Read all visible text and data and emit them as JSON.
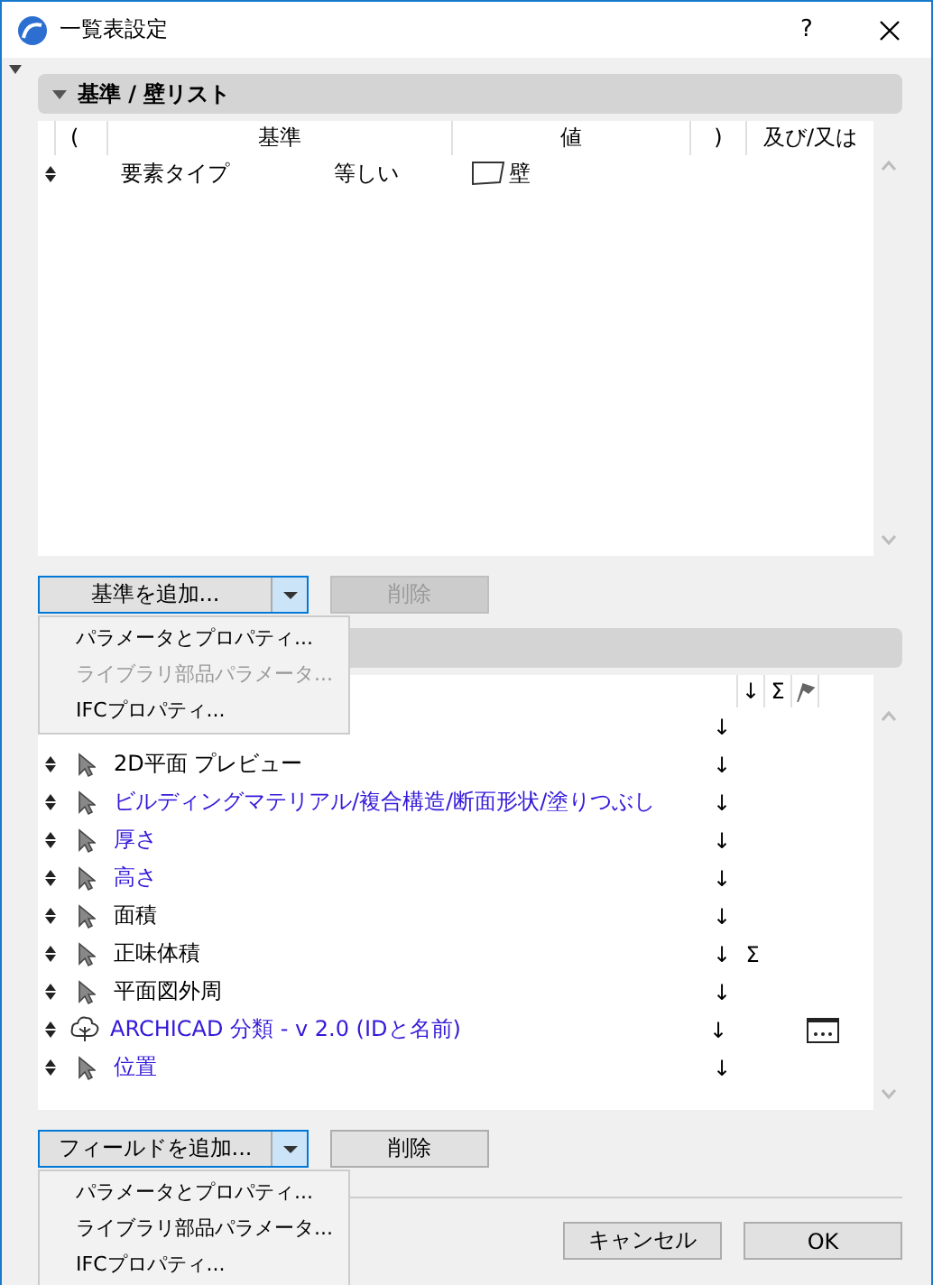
{
  "window": {
    "title": "一覧表設定",
    "help": "?"
  },
  "criteria_section": {
    "title": "基準 /  壁リスト",
    "expanded": true
  },
  "criteria_table": {
    "columns": [
      "(",
      "基準",
      "値",
      ")",
      "及び/又は"
    ],
    "rows": [
      {
        "criterion": "要素タイプ",
        "operator": "等しい",
        "value": "壁"
      }
    ]
  },
  "criteria_buttons": {
    "add": "基準を追加...",
    "delete": "削除",
    "delete_disabled": true
  },
  "criteria_menu": [
    {
      "label": "パラメータとプロパティ...",
      "disabled": false
    },
    {
      "label": "ライブラリ部品パラメータ...",
      "disabled": true
    },
    {
      "label": "IFCプロパティ...",
      "disabled": false
    }
  ],
  "fields_header": {
    "sort": "↓",
    "sum": "Σ"
  },
  "fields": [
    {
      "sort": "↓"
    },
    {
      "kind": "cursor",
      "name": "2D平面 プレビュー",
      "color": "#000000",
      "sort": "↓"
    },
    {
      "kind": "cursor",
      "name": "ビルディングマテリアル/複合構造/断面形状/塗りつぶし",
      "color": "#3319d9",
      "sort": "↓"
    },
    {
      "kind": "cursor",
      "name": "厚さ",
      "color": "#3319d9",
      "sort": "↓"
    },
    {
      "kind": "cursor",
      "name": "高さ",
      "color": "#3319d9",
      "sort": "↓"
    },
    {
      "kind": "cursor",
      "name": "面積",
      "color": "#000000",
      "sort": "↓"
    },
    {
      "kind": "cursor",
      "name": "正味体積",
      "color": "#000000",
      "sort": "↓",
      "sum": "Σ"
    },
    {
      "kind": "cursor",
      "name": "平面図外周",
      "color": "#000000",
      "sort": "↓"
    },
    {
      "kind": "tree",
      "name": "ARCHICAD 分類 - v 2.0 (IDと名前)",
      "color": "#3319d9",
      "sort": "↓",
      "options": true
    },
    {
      "kind": "cursor",
      "name": "位置",
      "color": "#3319d9",
      "sort": "↓"
    }
  ],
  "fields_buttons": {
    "add": "フィールドを追加...",
    "delete": "削除",
    "delete_disabled": false
  },
  "fields_menu": [
    {
      "label": "パラメータとプロパティ...",
      "disabled": false
    },
    {
      "label": "ライブラリ部品パラメータ...",
      "disabled": false
    },
    {
      "label": "IFCプロパティ...",
      "disabled": false
    }
  ],
  "dialog_buttons": {
    "cancel": "キャンセル",
    "ok": "OK"
  }
}
